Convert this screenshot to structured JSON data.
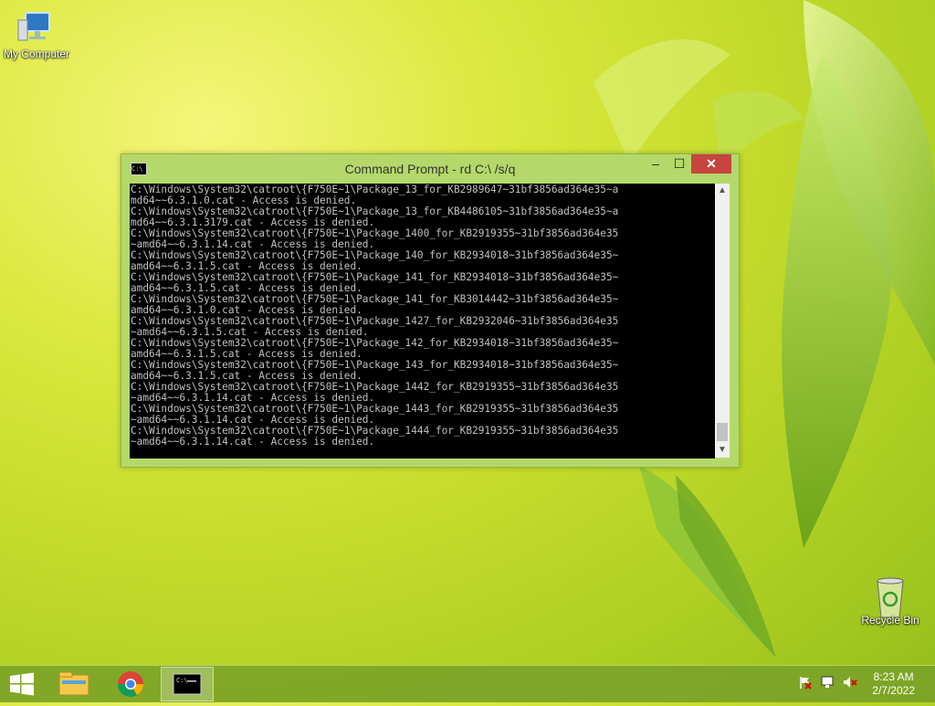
{
  "desktop": {
    "icons": [
      {
        "label": "My Computer",
        "icon": "computer-icon"
      },
      {
        "label": "Recycle Bin",
        "icon": "recycle-bin-icon"
      }
    ]
  },
  "window": {
    "title": "Command Prompt - rd  C:\\ /s/q",
    "buttons": {
      "minimize": "–",
      "maximize": "☐",
      "close": "✕"
    },
    "console_lines": [
      "C:\\Windows\\System32\\catroot\\{F750E~1\\Package_13_for_KB2989647~31bf3856ad364e35~a",
      "md64~~6.3.1.0.cat - Access is denied.",
      "C:\\Windows\\System32\\catroot\\{F750E~1\\Package_13_for_KB4486105~31bf3856ad364e35~a",
      "md64~~6.3.1.3179.cat - Access is denied.",
      "C:\\Windows\\System32\\catroot\\{F750E~1\\Package_1400_for_KB2919355~31bf3856ad364e35",
      "~amd64~~6.3.1.14.cat - Access is denied.",
      "C:\\Windows\\System32\\catroot\\{F750E~1\\Package_140_for_KB2934018~31bf3856ad364e35~",
      "amd64~~6.3.1.5.cat - Access is denied.",
      "C:\\Windows\\System32\\catroot\\{F750E~1\\Package_141_for_KB2934018~31bf3856ad364e35~",
      "amd64~~6.3.1.5.cat - Access is denied.",
      "C:\\Windows\\System32\\catroot\\{F750E~1\\Package_141_for_KB3014442~31bf3856ad364e35~",
      "amd64~~6.3.1.0.cat - Access is denied.",
      "C:\\Windows\\System32\\catroot\\{F750E~1\\Package_1427_for_KB2932046~31bf3856ad364e35",
      "~amd64~~6.3.1.5.cat - Access is denied.",
      "C:\\Windows\\System32\\catroot\\{F750E~1\\Package_142_for_KB2934018~31bf3856ad364e35~",
      "amd64~~6.3.1.5.cat - Access is denied.",
      "C:\\Windows\\System32\\catroot\\{F750E~1\\Package_143_for_KB2934018~31bf3856ad364e35~",
      "amd64~~6.3.1.5.cat - Access is denied.",
      "C:\\Windows\\System32\\catroot\\{F750E~1\\Package_1442_for_KB2919355~31bf3856ad364e35",
      "~amd64~~6.3.1.14.cat - Access is denied.",
      "C:\\Windows\\System32\\catroot\\{F750E~1\\Package_1443_for_KB2919355~31bf3856ad364e35",
      "~amd64~~6.3.1.14.cat - Access is denied.",
      "C:\\Windows\\System32\\catroot\\{F750E~1\\Package_1444_for_KB2919355~31bf3856ad364e35",
      "~amd64~~6.3.1.14.cat - Access is denied."
    ]
  },
  "taskbar": {
    "items": [
      {
        "name": "start-button",
        "icon": "windows-logo-icon"
      },
      {
        "name": "file-explorer",
        "icon": "folder-icon"
      },
      {
        "name": "chrome",
        "icon": "chrome-icon"
      },
      {
        "name": "command-prompt",
        "icon": "cmd-icon",
        "active": true
      }
    ],
    "tray_icons": [
      "action-center-flag-icon",
      "network-icon",
      "volume-muted-icon"
    ],
    "clock": {
      "time": "8:23 AM",
      "date": "2/7/2022"
    }
  },
  "colors": {
    "close_button": "#c7453f",
    "window_frame": "#b4d96a",
    "console_bg": "#000000",
    "console_text": "#c0c0c0"
  }
}
